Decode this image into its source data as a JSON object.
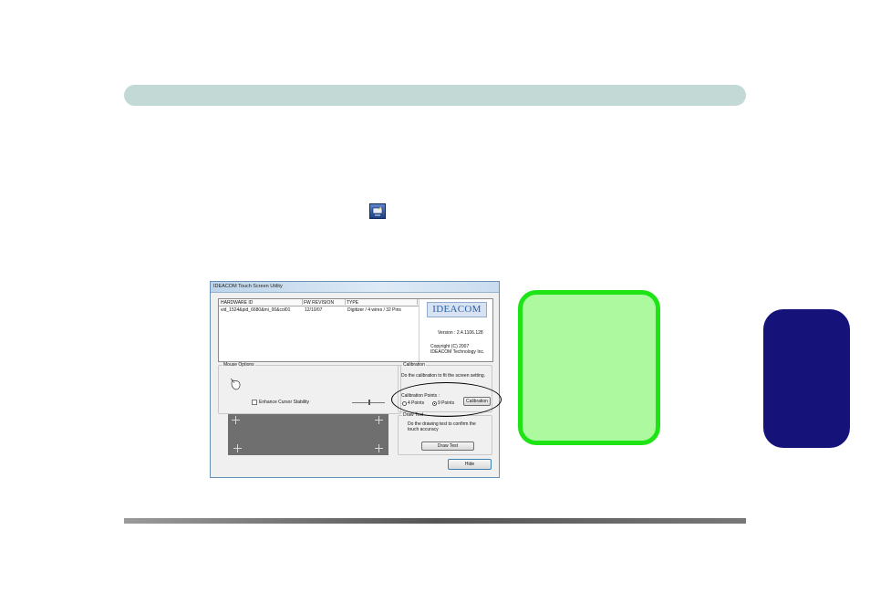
{
  "window": {
    "title": "IDEACOM Touch Screen Utility",
    "columns": [
      "HARDWARE ID",
      "FW REVISION",
      "TYPE"
    ],
    "rows": [
      [
        "vid_1524&pid_6680&mi_00&col01",
        "12/10/07",
        "Digitizer / 4 wires / 32 Pins"
      ]
    ],
    "logo_text": "IDEACOM",
    "version": "Version :  2.4.1106.128",
    "copyright_line1": "Copyright (C) 2007",
    "copyright_line2": "IDEACOM Technology Inc.",
    "mouse_options": {
      "title": "Mouse Options",
      "enhance_label": "Enhance Cursor Stability",
      "enhance_checked": false
    },
    "calibration": {
      "title": "Calibration",
      "description": "Do the calibration to fit the screen setting.",
      "points_label": "Calibration Points :",
      "option_4": "4 Points",
      "option_9": "9 Points",
      "selected": "9 Points",
      "button": "Calibration"
    },
    "draw_test": {
      "title": "Draw Test",
      "desc_line1": "Do the drawing test to confirm the",
      "desc_line2": "touch accuracy",
      "button": "Draw Test"
    },
    "hide_button": "Hide"
  },
  "colors": {
    "header_bar": "#c3d9d6",
    "side_tab": "#15137a",
    "note_fill": "#adf9a0",
    "note_border": "#1ee416"
  }
}
